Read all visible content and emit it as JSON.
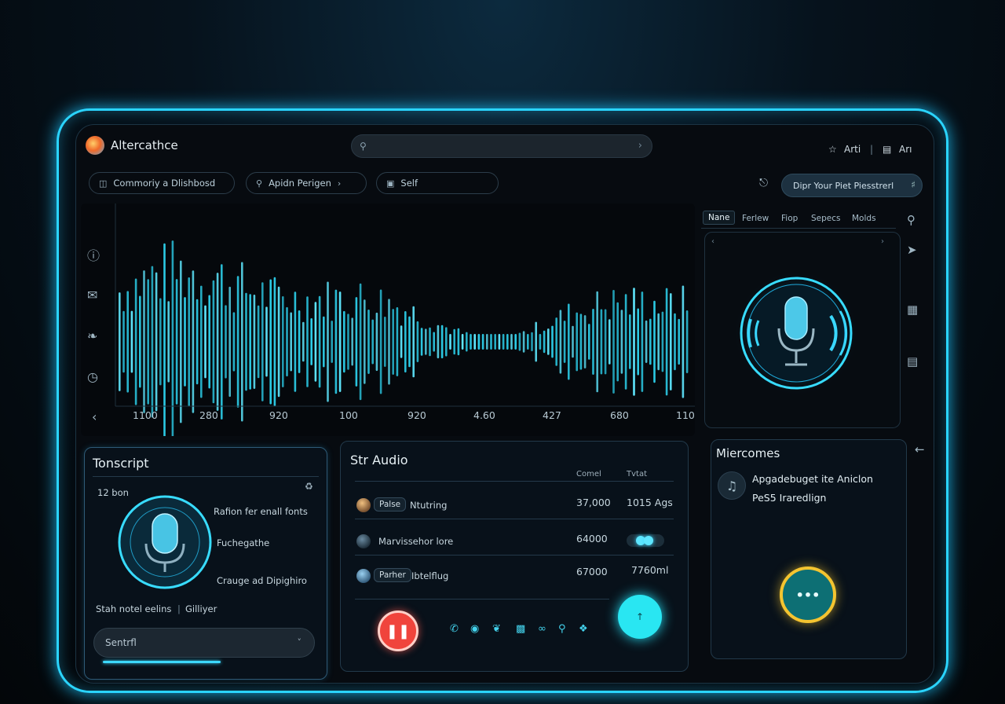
{
  "header": {
    "app_title": "Altercathce",
    "search": {
      "placeholder": ""
    },
    "right_item_1": "Arti",
    "right_item_2": "Arı",
    "separator": "|"
  },
  "nav": {
    "pills": [
      {
        "label": "Commoriy a Dlishbosd",
        "icon": "dashboard-icon"
      },
      {
        "label": "Apidn Perigen",
        "icon": "search-icon"
      },
      {
        "label": "Self",
        "icon": "lock-icon"
      }
    ],
    "cta_label": "Dipr Your Piet Piesstrerl"
  },
  "waveform": {
    "ticks": [
      "1100",
      "280",
      "920",
      "100",
      "920",
      "4.60",
      "427",
      "680",
      "110"
    ],
    "left_icons": [
      "info-icon",
      "mail-icon",
      "leaf-icon",
      "history-icon"
    ]
  },
  "right_panel": {
    "tabs": [
      "Nane",
      "Ferlew",
      "Fiop",
      "Sepecs",
      "Molds"
    ],
    "active_tab": 0
  },
  "transcript": {
    "title": "Tonscript",
    "time": "12 bon",
    "labels": [
      "Rafion fer enall fonts",
      "Fuchegathe",
      "Crauge ad Dipighiro"
    ],
    "footer": "Stah notel eelins",
    "footer_sep": "|",
    "footer_right": "Gilliyer",
    "select_value": "Sentrfl",
    "progress": 0.5
  },
  "audio": {
    "title": "Str Audio",
    "col1": "Comel",
    "col2": "Tvtat",
    "rows": [
      {
        "tag": "Palse",
        "name": "Ntutring",
        "value": "37,000",
        "extra": "1015 Ags"
      },
      {
        "tag": "",
        "name": "Marvissehor lore",
        "value": "64000",
        "extra": ""
      },
      {
        "tag": "Parher",
        "name": "Ibtelflug",
        "value": "67000",
        "extra": "7760ml"
      }
    ],
    "play_label": "❚❚",
    "cyan_label": "↑"
  },
  "microcomes": {
    "title": "Miercomes",
    "line1": "Apgadebuget ite Aniclon",
    "line2": "PeS5 Iraredlign",
    "button_label": "•••"
  },
  "colors": {
    "accent": "#2ad4ff",
    "record": "#f0443c",
    "gold": "#f4c430"
  }
}
